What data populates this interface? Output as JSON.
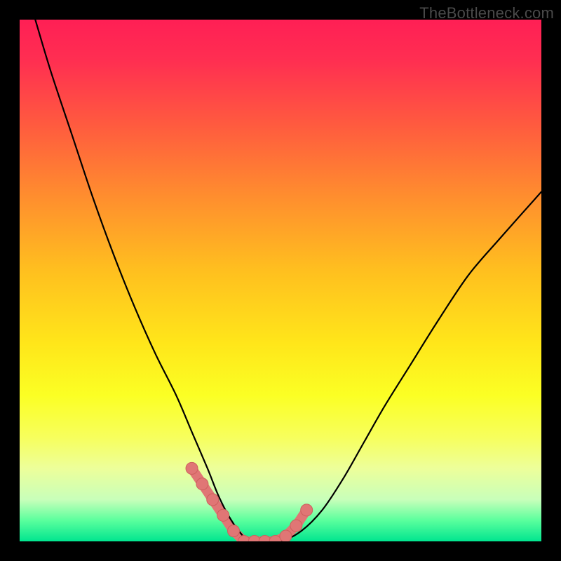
{
  "watermark": "TheBottleneck.com",
  "colors": {
    "background": "#000000",
    "gradient_top": "#ff1f55",
    "gradient_mid": "#ffe61a",
    "gradient_bottom": "#00e58f",
    "curve_stroke": "#000000",
    "dot_fill": "#e07675"
  },
  "chart_data": {
    "type": "line",
    "title": "",
    "xlabel": "",
    "ylabel": "",
    "xlim": [
      0,
      100
    ],
    "ylim": [
      0,
      100
    ],
    "series": [
      {
        "name": "bottleneck-curve",
        "x": [
          3,
          6,
          10,
          14,
          18,
          22,
          26,
          30,
          33,
          36,
          38,
          40,
          42,
          44,
          46,
          50,
          54,
          58,
          62,
          66,
          70,
          75,
          80,
          86,
          92,
          100
        ],
        "values": [
          100,
          90,
          78,
          66,
          55,
          45,
          36,
          28,
          21,
          14,
          9,
          5,
          2,
          0,
          0,
          0,
          2,
          6,
          12,
          19,
          26,
          34,
          42,
          51,
          58,
          67
        ]
      }
    ],
    "highlight_points": {
      "name": "salmon-dots",
      "x": [
        33,
        35,
        37,
        39,
        41,
        43,
        45,
        47,
        49,
        51,
        53,
        55
      ],
      "values": [
        14,
        11,
        8,
        5,
        2,
        0,
        0,
        0,
        0,
        1,
        3,
        6
      ]
    }
  }
}
